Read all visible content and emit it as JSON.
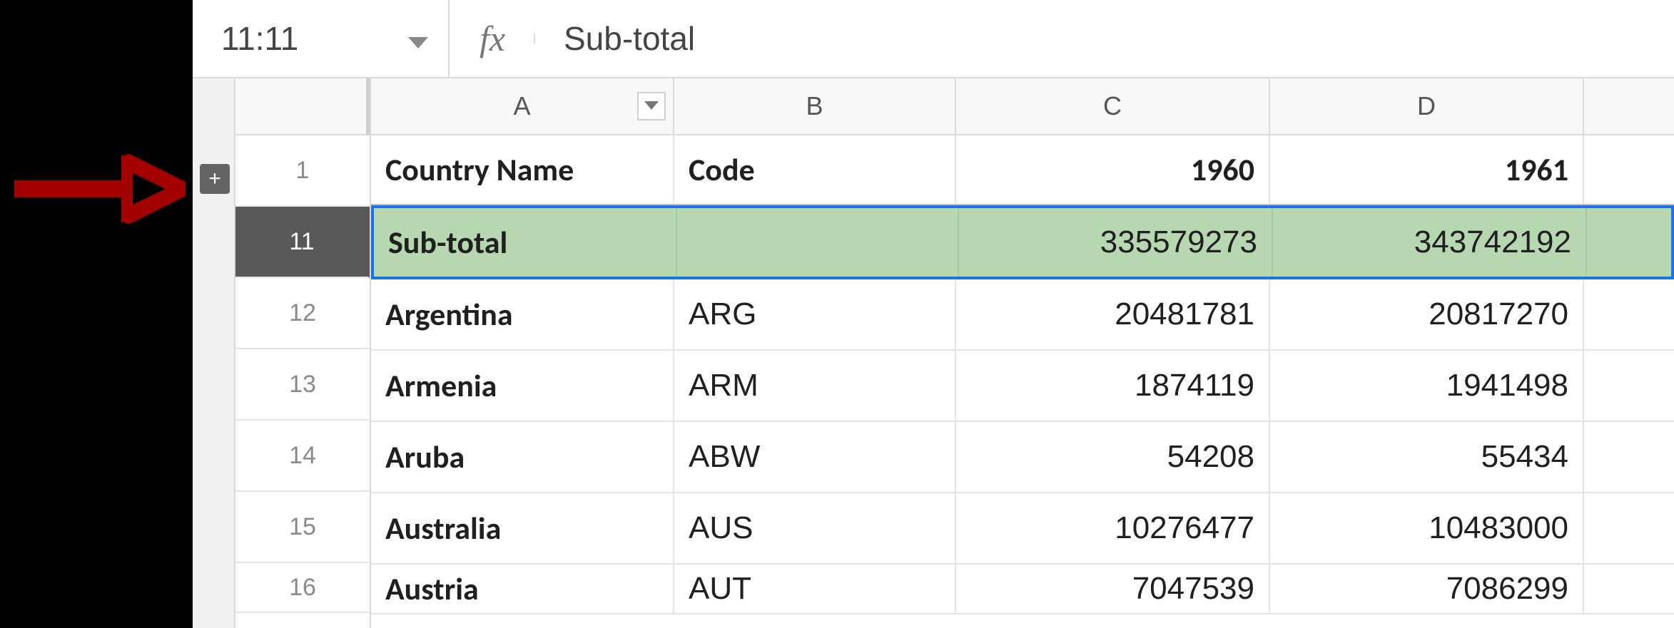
{
  "name_box": "11:11",
  "formula_label": "fx",
  "formula_value": "Sub-total",
  "columns": {
    "A": "A",
    "B": "B",
    "C": "C",
    "D": "D"
  },
  "header_row": {
    "num": "1",
    "country": "Country Name",
    "code": "Code",
    "y1": "1960",
    "y2": "1961"
  },
  "subtotal_row": {
    "num": "11",
    "country": "Sub-total",
    "code": "",
    "y1": "335579273",
    "y2": "343742192"
  },
  "rows": [
    {
      "num": "12",
      "country": "Argentina",
      "code": "ARG",
      "y1": "20481781",
      "y2": "20817270"
    },
    {
      "num": "13",
      "country": "Armenia",
      "code": "ARM",
      "y1": "1874119",
      "y2": "1941498"
    },
    {
      "num": "14",
      "country": "Aruba",
      "code": "ABW",
      "y1": "54208",
      "y2": "55434"
    },
    {
      "num": "15",
      "country": "Australia",
      "code": "AUS",
      "y1": "10276477",
      "y2": "10483000"
    },
    {
      "num": "16",
      "country": "Austria",
      "code": "AUT",
      "y1": "7047539",
      "y2": "7086299"
    }
  ],
  "expand_glyph": "+"
}
